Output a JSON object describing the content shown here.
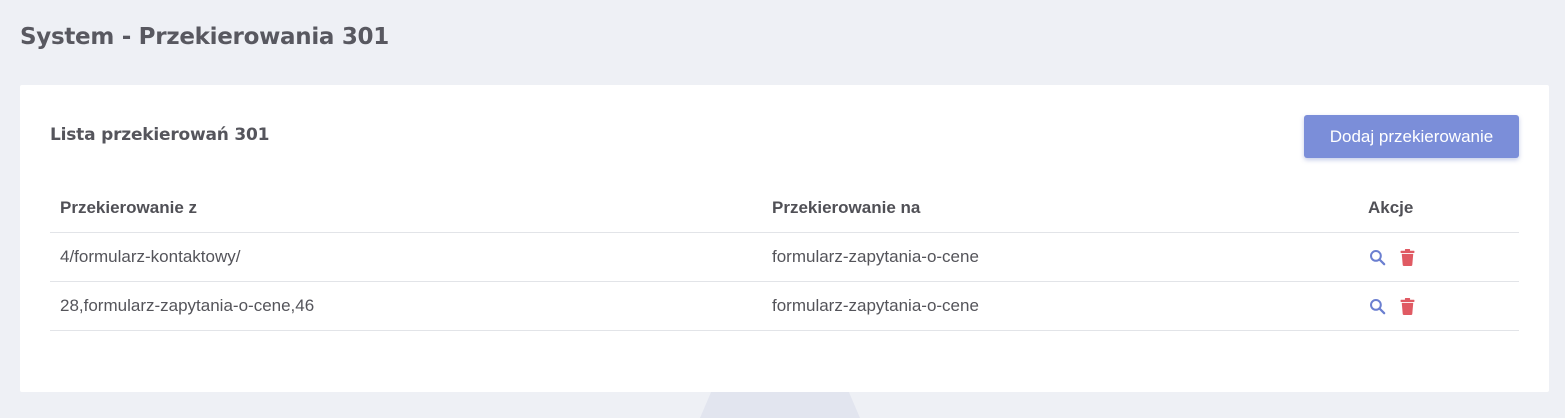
{
  "page": {
    "title": "System - Przekierowania 301"
  },
  "card": {
    "title": "Lista przekierowań 301",
    "add_button_label": "Dodaj przekierowanie"
  },
  "table": {
    "columns": [
      "Przekierowanie z",
      "Przekierowanie na",
      "Akcje"
    ],
    "rows": [
      {
        "from": "4/formularz-kontaktowy/",
        "to": "formularz-zapytania-o-cene",
        "actions": [
          "search-icon",
          "trash-icon"
        ]
      },
      {
        "from": "28,formularz-zapytania-o-cene,46",
        "to": "formularz-zapytania-o-cene",
        "actions": [
          "search-icon",
          "trash-icon"
        ]
      }
    ]
  },
  "colors": {
    "accent": "#7b8ed9",
    "search_icon": "#6b7fd0",
    "delete_icon": "#e05a63"
  }
}
